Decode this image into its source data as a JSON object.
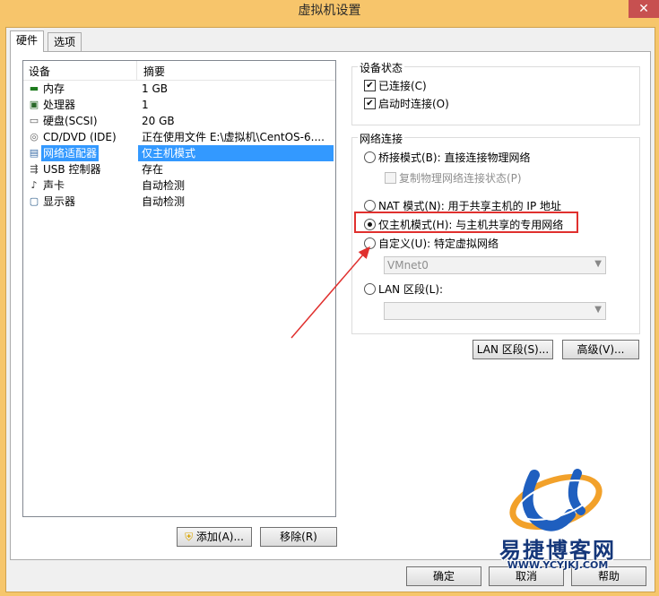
{
  "window": {
    "title": "虚拟机设置",
    "close": "✕"
  },
  "tabs": [
    {
      "label": "硬件"
    },
    {
      "label": "选项"
    }
  ],
  "devices": {
    "headers": {
      "device": "设备",
      "summary": "摘要"
    },
    "rows": [
      {
        "icon": "memory-icon",
        "name": "内存",
        "summary": "1 GB"
      },
      {
        "icon": "cpu-icon",
        "name": "处理器",
        "summary": "1"
      },
      {
        "icon": "disk-icon",
        "name": "硬盘(SCSI)",
        "summary": "20 GB"
      },
      {
        "icon": "cd-icon",
        "name": "CD/DVD (IDE)",
        "summary": "正在使用文件 E:\\虚拟机\\CentOS-6...."
      },
      {
        "icon": "network-icon",
        "name": "网络适配器",
        "summary": "仅主机模式"
      },
      {
        "icon": "usb-icon",
        "name": "USB 控制器",
        "summary": "存在"
      },
      {
        "icon": "sound-icon",
        "name": "声卡",
        "summary": "自动检测"
      },
      {
        "icon": "display-icon",
        "name": "显示器",
        "summary": "自动检测"
      }
    ],
    "selected_index": 4
  },
  "buttons": {
    "add": "添加(A)...",
    "remove": "移除(R)",
    "lan_segments": "LAN 区段(S)...",
    "advanced": "高级(V)...",
    "ok": "确定",
    "cancel": "取消",
    "help": "帮助"
  },
  "device_status": {
    "title": "设备状态",
    "connected": {
      "label": "已连接(C)",
      "checked": true
    },
    "connect_at_power_on": {
      "label": "启动时连接(O)",
      "checked": true
    }
  },
  "network_connection": {
    "title": "网络连接",
    "bridged": "桥接模式(B): 直接连接物理网络",
    "replicate": "复制物理网络连接状态(P)",
    "nat": "NAT 模式(N): 用于共享主机的 IP 地址",
    "host_only": "仅主机模式(H): 与主机共享的专用网络",
    "custom": "自定义(U): 特定虚拟网络",
    "custom_value": "VMnet0",
    "lan_segment": "LAN 区段(L):",
    "lan_segment_value": "",
    "selected": "host_only"
  },
  "watermark": {
    "brand": "易捷博客网",
    "url": "WWW.YCYJKJ.COM"
  },
  "colors": {
    "selection": "#3399ff",
    "highlight": "#e0302e",
    "arrow": "#e0302e",
    "titlebar": "#f7c56b"
  }
}
